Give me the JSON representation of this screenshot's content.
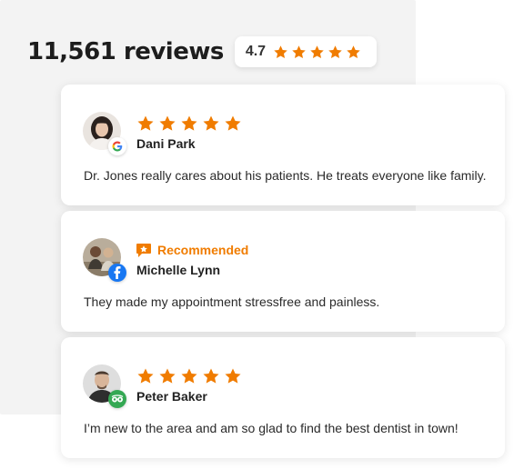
{
  "summary": {
    "review_count": "11,561 reviews",
    "rating": "4.7",
    "stars": 5
  },
  "colors": {
    "star": "#F07C00",
    "recommended": "#F07C00",
    "facebook": "#1877F2",
    "tripadvisor": "#34A853"
  },
  "reviews": [
    {
      "name": "Dani Park",
      "source_icon": "google-icon",
      "stars": 5,
      "text": "Dr. Jones really cares about his patients. He treats everyone like family."
    },
    {
      "name": "Michelle Lynn",
      "source_icon": "facebook-icon",
      "recommended_label": "Recommended",
      "text": "They made my appointment stressfree and painless."
    },
    {
      "name": "Peter Baker",
      "source_icon": "tripadvisor-icon",
      "stars": 5,
      "text": "I’m new to the area and am so glad to find the best dentist in town!"
    }
  ]
}
